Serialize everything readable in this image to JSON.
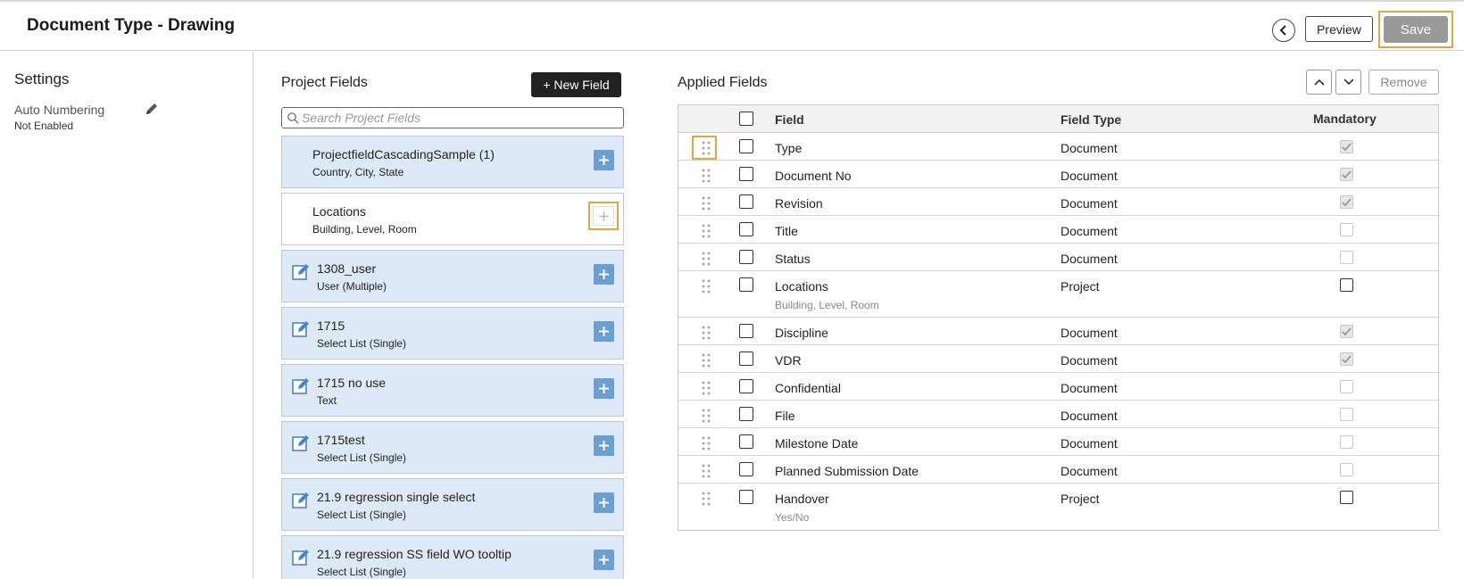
{
  "header": {
    "title": "Document Type - Drawing",
    "preview_label": "Preview",
    "save_label": "Save"
  },
  "settings": {
    "title": "Settings",
    "auto_numbering_label": "Auto Numbering",
    "auto_numbering_value": "Not Enabled"
  },
  "project_fields": {
    "title": "Project Fields",
    "new_field_label": "+ New Field",
    "search_placeholder": "Search Project Fields",
    "items": [
      {
        "name": "ProjectfieldCascadingSample (1)",
        "sub": "Country, City, State"
      },
      {
        "name": "Locations",
        "sub": "Building, Level, Room"
      },
      {
        "name": "1308_user",
        "sub": "User (Multiple)"
      },
      {
        "name": "1715",
        "sub": "Select List (Single)"
      },
      {
        "name": "1715 no use",
        "sub": "Text"
      },
      {
        "name": "1715test",
        "sub": "Select List (Single)"
      },
      {
        "name": "21.9 regression single select",
        "sub": "Select List (Single)"
      },
      {
        "name": "21.9 regression SS field WO tooltip",
        "sub": "Select List (Single)"
      }
    ]
  },
  "applied_fields": {
    "title": "Applied Fields",
    "remove_label": "Remove",
    "columns": {
      "field": "Field",
      "field_type": "Field Type",
      "mandatory": "Mandatory"
    },
    "rows": [
      {
        "field": "Type",
        "sub": "",
        "type": "Document",
        "mandatory": "checked"
      },
      {
        "field": "Document No",
        "sub": "",
        "type": "Document",
        "mandatory": "checked"
      },
      {
        "field": "Revision",
        "sub": "",
        "type": "Document",
        "mandatory": "checked"
      },
      {
        "field": "Title",
        "sub": "",
        "type": "Document",
        "mandatory": "disabled"
      },
      {
        "field": "Status",
        "sub": "",
        "type": "Document",
        "mandatory": "disabled"
      },
      {
        "field": "Locations",
        "sub": "Building, Level, Room",
        "type": "Project",
        "mandatory": "enabled"
      },
      {
        "field": "Discipline",
        "sub": "",
        "type": "Document",
        "mandatory": "checked"
      },
      {
        "field": "VDR",
        "sub": "",
        "type": "Document",
        "mandatory": "checked"
      },
      {
        "field": "Confidential",
        "sub": "",
        "type": "Document",
        "mandatory": "disabled"
      },
      {
        "field": "File",
        "sub": "",
        "type": "Document",
        "mandatory": "disabled"
      },
      {
        "field": "Milestone Date",
        "sub": "",
        "type": "Document",
        "mandatory": "disabled"
      },
      {
        "field": "Planned Submission Date",
        "sub": "",
        "type": "Document",
        "mandatory": "disabled"
      },
      {
        "field": "Handover",
        "sub": "Yes/No",
        "type": "Project",
        "mandatory": "enabled"
      }
    ]
  },
  "colors": {
    "accent_highlight": "#e8a33d",
    "add_button": "#6a9fd1",
    "item_background": "#dde9f7",
    "save_button": "#999999"
  }
}
